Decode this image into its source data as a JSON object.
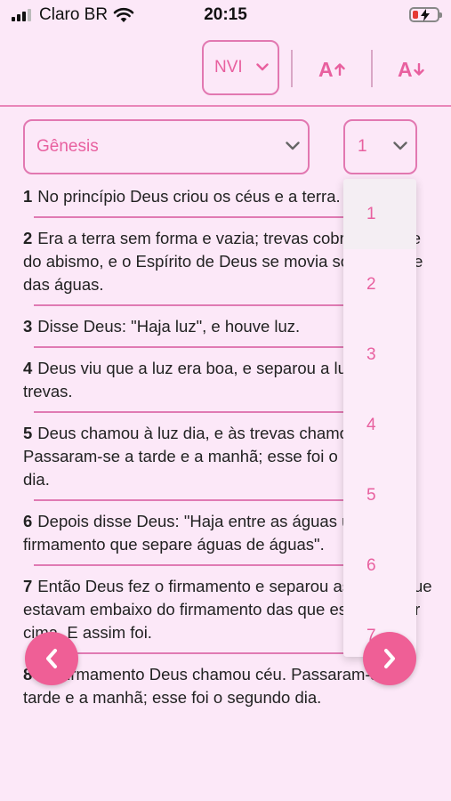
{
  "status_bar": {
    "carrier": "Claro BR",
    "time": "20:15"
  },
  "toolbar": {
    "version": "NVI",
    "increase_font": "A",
    "decrease_font": "A"
  },
  "selectors": {
    "book": "Gênesis",
    "chapter": "1"
  },
  "chapter_options": [
    "1",
    "2",
    "3",
    "4",
    "5",
    "6",
    "7"
  ],
  "verses": [
    {
      "num": "1",
      "text": "No princípio Deus criou os céus e a terra."
    },
    {
      "num": "2",
      "text": "Era a terra sem forma e vazia; trevas cobriam a face do abismo, e o Espírito de Deus se movia sobre a face das águas."
    },
    {
      "num": "3",
      "text": "Disse Deus: \"Haja luz\", e houve luz."
    },
    {
      "num": "4",
      "text": "Deus viu que a luz era boa, e separou a luz das trevas."
    },
    {
      "num": "5",
      "text": "Deus chamou à luz dia, e às trevas chamou noite. Passaram-se a tarde e a manhã; esse foi o primeiro dia."
    },
    {
      "num": "6",
      "text": "Depois disse Deus: \"Haja entre as águas um firmamento que separe águas de águas\"."
    },
    {
      "num": "7",
      "text": "Então Deus fez o firmamento e separou as águas que estavam embaixo do firmamento das que estavam por cima. E assim foi."
    },
    {
      "num": "8",
      "text": "Ao firmamento Deus chamou céu. Passaram-se a tarde e a manhã; esse foi o segundo dia."
    }
  ],
  "colors": {
    "accent": "#e8609f",
    "background": "#fce8f8",
    "fab": "#ef5f96"
  }
}
